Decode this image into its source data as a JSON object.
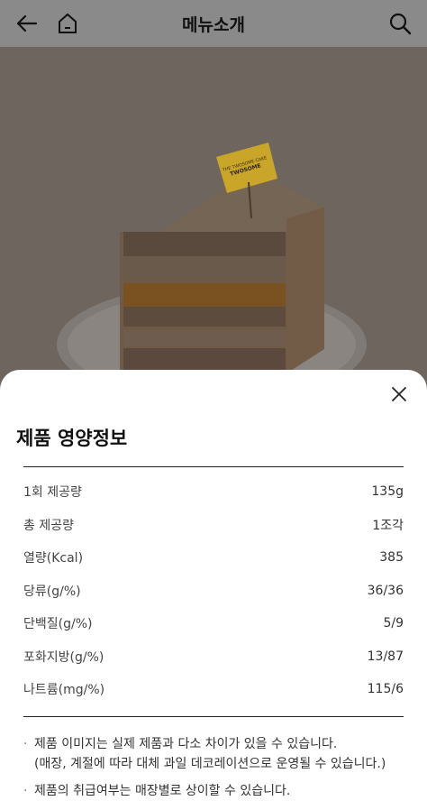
{
  "header": {
    "title": "메뉴소개"
  },
  "hero": {
    "topper_line1": "THE TWOSOME CAKE",
    "topper_brand": "TWOSOME"
  },
  "nutrition": {
    "title": "제품 영양정보",
    "rows": [
      {
        "label": "1회 제공량",
        "value": "135g"
      },
      {
        "label": "총 제공량",
        "value": "1조각"
      },
      {
        "label": "열량(Kcal)",
        "value": "385"
      },
      {
        "label": "당류(g/%)",
        "value": "36/36"
      },
      {
        "label": "단백질(g/%)",
        "value": "5/9"
      },
      {
        "label": "포화지방(g/%)",
        "value": "13/87"
      },
      {
        "label": "나트륨(mg/%)",
        "value": "115/6"
      }
    ],
    "notes": {
      "note1": "제품 이미지는 실제 제품과 다소 차이가 있을 수 있습니다.",
      "note1_sub": "(매장, 계절에 따라 대체 과일 데코레이션으로 운영될 수 있습니다.)",
      "note2": "제품의 취급여부는 매장별로 상이할 수 있습니다."
    }
  }
}
